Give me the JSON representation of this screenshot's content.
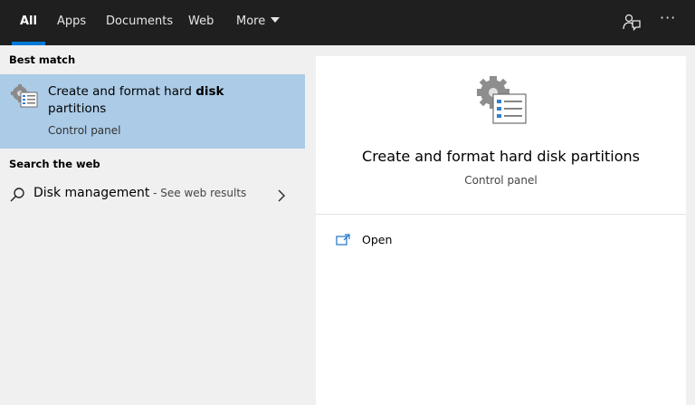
{
  "tabs": [
    {
      "label": "All",
      "active": true
    },
    {
      "label": "Apps"
    },
    {
      "label": "Documents"
    },
    {
      "label": "Web"
    },
    {
      "label": "More"
    }
  ],
  "top_icons": [
    "feedback-icon",
    "more-options-icon"
  ],
  "more_dots": "···",
  "best_match": {
    "section_label": "Best match",
    "title_prefix": "Create and format hard ",
    "title_bold": "disk",
    "title_suffix": "partitions",
    "subtitle": "Control panel",
    "icon": "control-panel-icon"
  },
  "search_web": {
    "section_label": "Search the web",
    "query": "Disk management",
    "separator": " - ",
    "hint": "See web results"
  },
  "detail": {
    "title": "Create and format hard disk partitions",
    "subtitle": "Control panel",
    "actions": [
      {
        "label": "Open",
        "icon": "open-icon"
      }
    ]
  },
  "colors": {
    "topbar": "#1f1f1f",
    "accent": "#0078d7",
    "selected": "#abcbe7",
    "pane_bg": "#f0f0f0",
    "detail_bg": "#ffffff"
  }
}
